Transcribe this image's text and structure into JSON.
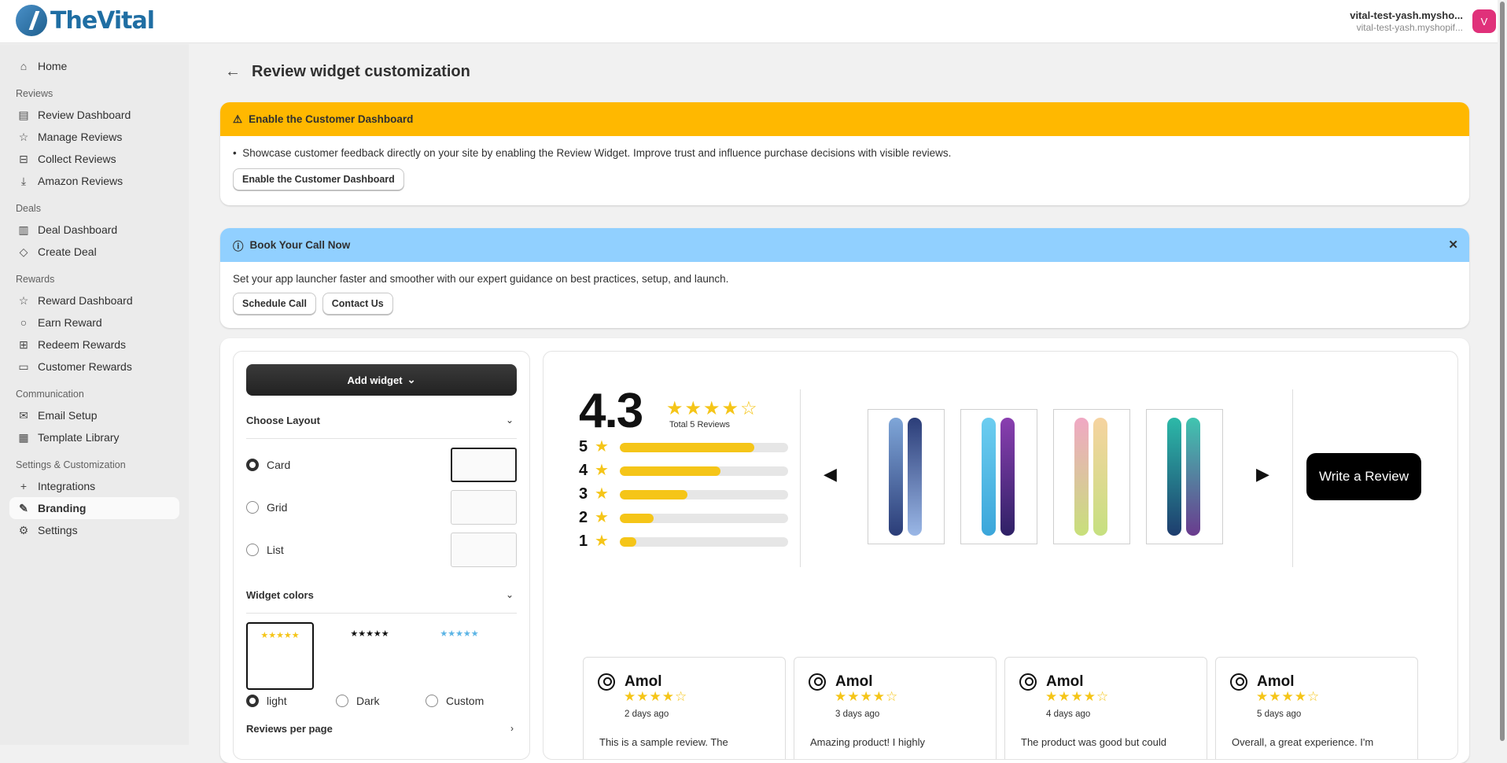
{
  "app": {
    "name": "TheVital"
  },
  "store": {
    "name": "vital-test-yash.mysho...",
    "subtitle": "vital-test-yash.myshopif...",
    "avatar_letter": "V"
  },
  "sidebar": {
    "home": "Home",
    "sections": {
      "reviews": "Reviews",
      "deals": "Deals",
      "rewards": "Rewards",
      "communication": "Communication",
      "settings": "Settings & Customization"
    },
    "items": {
      "review_dashboard": "Review Dashboard",
      "manage_reviews": "Manage Reviews",
      "collect_reviews": "Collect Reviews",
      "amazon_reviews": "Amazon Reviews",
      "deal_dashboard": "Deal Dashboard",
      "create_deal": "Create Deal",
      "reward_dashboard": "Reward Dashboard",
      "earn_reward": "Earn Reward",
      "redeem_rewards": "Redeem Rewards",
      "customer_rewards": "Customer Rewards",
      "email_setup": "Email Setup",
      "template_library": "Template Library",
      "integrations": "Integrations",
      "branding": "Branding",
      "settings": "Settings"
    },
    "active": "branding"
  },
  "page": {
    "title": "Review widget customization"
  },
  "enable_banner": {
    "title": "Enable the Customer Dashboard",
    "bullet": "Showcase customer feedback directly on your site by enabling the Review Widget. Improve trust and influence purchase decisions with visible reviews.",
    "button": "Enable the Customer Dashboard",
    "color": "#ffb800"
  },
  "call_banner": {
    "title": "Book Your Call Now",
    "text": "Set your app launcher faster and smoother with our expert guidance on best practices, setup, and launch.",
    "schedule_button": "Schedule Call",
    "contact_button": "Contact Us",
    "color": "#91d0ff"
  },
  "config": {
    "add_widget": "Add widget",
    "choose_layout": "Choose Layout",
    "layouts": [
      "Card",
      "Grid",
      "List"
    ],
    "selected_layout": "Card",
    "widget_colors": "Widget colors",
    "color_options": [
      "light",
      "Dark",
      "Custom"
    ],
    "selected_color": "light",
    "reviews_per_page": "Reviews per page"
  },
  "preview": {
    "rating": "4.3",
    "total": "Total 5 Reviews",
    "rating_stars": 4.3,
    "distribution": [
      {
        "stars": "5",
        "fill": 0.8
      },
      {
        "stars": "4",
        "fill": 0.6
      },
      {
        "stars": "3",
        "fill": 0.4
      },
      {
        "stars": "2",
        "fill": 0.2
      },
      {
        "stars": "1",
        "fill": 0.1
      }
    ],
    "write_review": "Write a Review",
    "star_color": "#f5c518",
    "reviews": [
      {
        "name": "Amol",
        "date": "2 days ago",
        "text": "This is a sample review. The",
        "stars": 4
      },
      {
        "name": "Amol",
        "date": "3 days ago",
        "text": "Amazing product! I highly",
        "stars": 4
      },
      {
        "name": "Amol",
        "date": "4 days ago",
        "text": "The product was good but could",
        "stars": 4
      },
      {
        "name": "Amol",
        "date": "5 days ago",
        "text": "Overall, a great experience. I'm",
        "stars": 4
      }
    ]
  }
}
